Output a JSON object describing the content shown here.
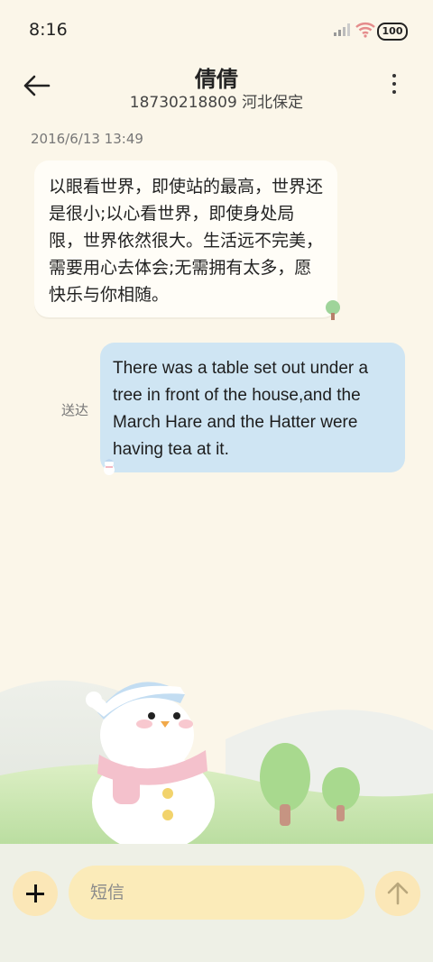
{
  "status_bar": {
    "time": "8:16",
    "battery": "100"
  },
  "header": {
    "title": "倩倩",
    "subtitle": "18730218809 河北保定"
  },
  "conversation": {
    "date": "2016/6/13 13:49",
    "incoming_text": "以眼看世界，即使站的最高，世界还是很小;以心看世界，即使身处局限，世界依然很大。生活远不完美，需要用心去体会;无需拥有太多，愿快乐与你相随。",
    "outgoing_text": "There was a table set out under a tree in front of the house,and the March Hare and the Hatter were having tea at it.",
    "outgoing_status": "送达"
  },
  "composer": {
    "placeholder": "短信"
  },
  "icons": {
    "back": "arrow-left-icon",
    "menu": "more-vertical-icon",
    "signal": "signal-icon",
    "wifi": "wifi-icon",
    "battery": "battery-icon",
    "add": "plus-icon",
    "send": "arrow-up-icon"
  },
  "colors": {
    "background": "#fbf6e9",
    "incoming_bubble": "#fffdf7",
    "outgoing_bubble": "#cfe5f3",
    "accent": "#fbe7b7"
  }
}
